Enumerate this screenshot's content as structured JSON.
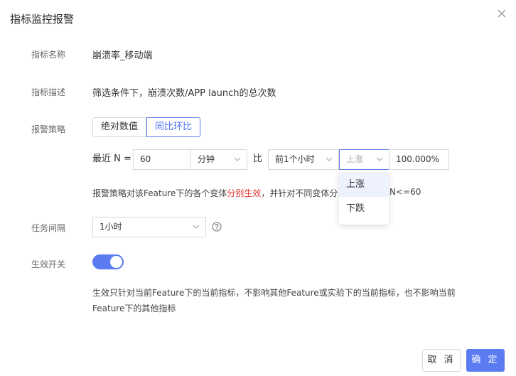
{
  "dialog": {
    "title": "指标监控报警",
    "cancel_label": "取 消",
    "ok_label": "确 定"
  },
  "fields": {
    "name_label": "指标名称",
    "name_value": "崩溃率_移动端",
    "desc_label": "指标描述",
    "desc_value": "筛选条件下，崩溃次数/APP launch的总次数",
    "strategy_label": "报警策略",
    "interval_label": "任务间隔",
    "switch_label": "生效开关"
  },
  "strategy": {
    "tabs": [
      "绝对数值",
      "同比环比"
    ],
    "active_tab": "同比环比",
    "recent_n_label": "最近 N =",
    "n_value": "60",
    "unit_value": "分钟",
    "compare_label": "比",
    "period_value": "前1个小时",
    "direction_value": "上涨",
    "direction_options": [
      "上涨",
      "下跌"
    ],
    "threshold_value": "100.000%",
    "note_before": "报警策略对该Feature下的各个变体",
    "note_highlight": "分别生效",
    "note_after": "，并针对不同变体分",
    "note_tail": "N<=60"
  },
  "interval": {
    "value": "1小时"
  },
  "switch": {
    "on": true,
    "description": "生效只针对当前Feature下的当前指标，不影响其他Feature或实验下的当前指标，也不影响当前Feature下的其他指标"
  },
  "colors": {
    "primary": "#5b7cf0",
    "highlight": "#e5322d"
  }
}
